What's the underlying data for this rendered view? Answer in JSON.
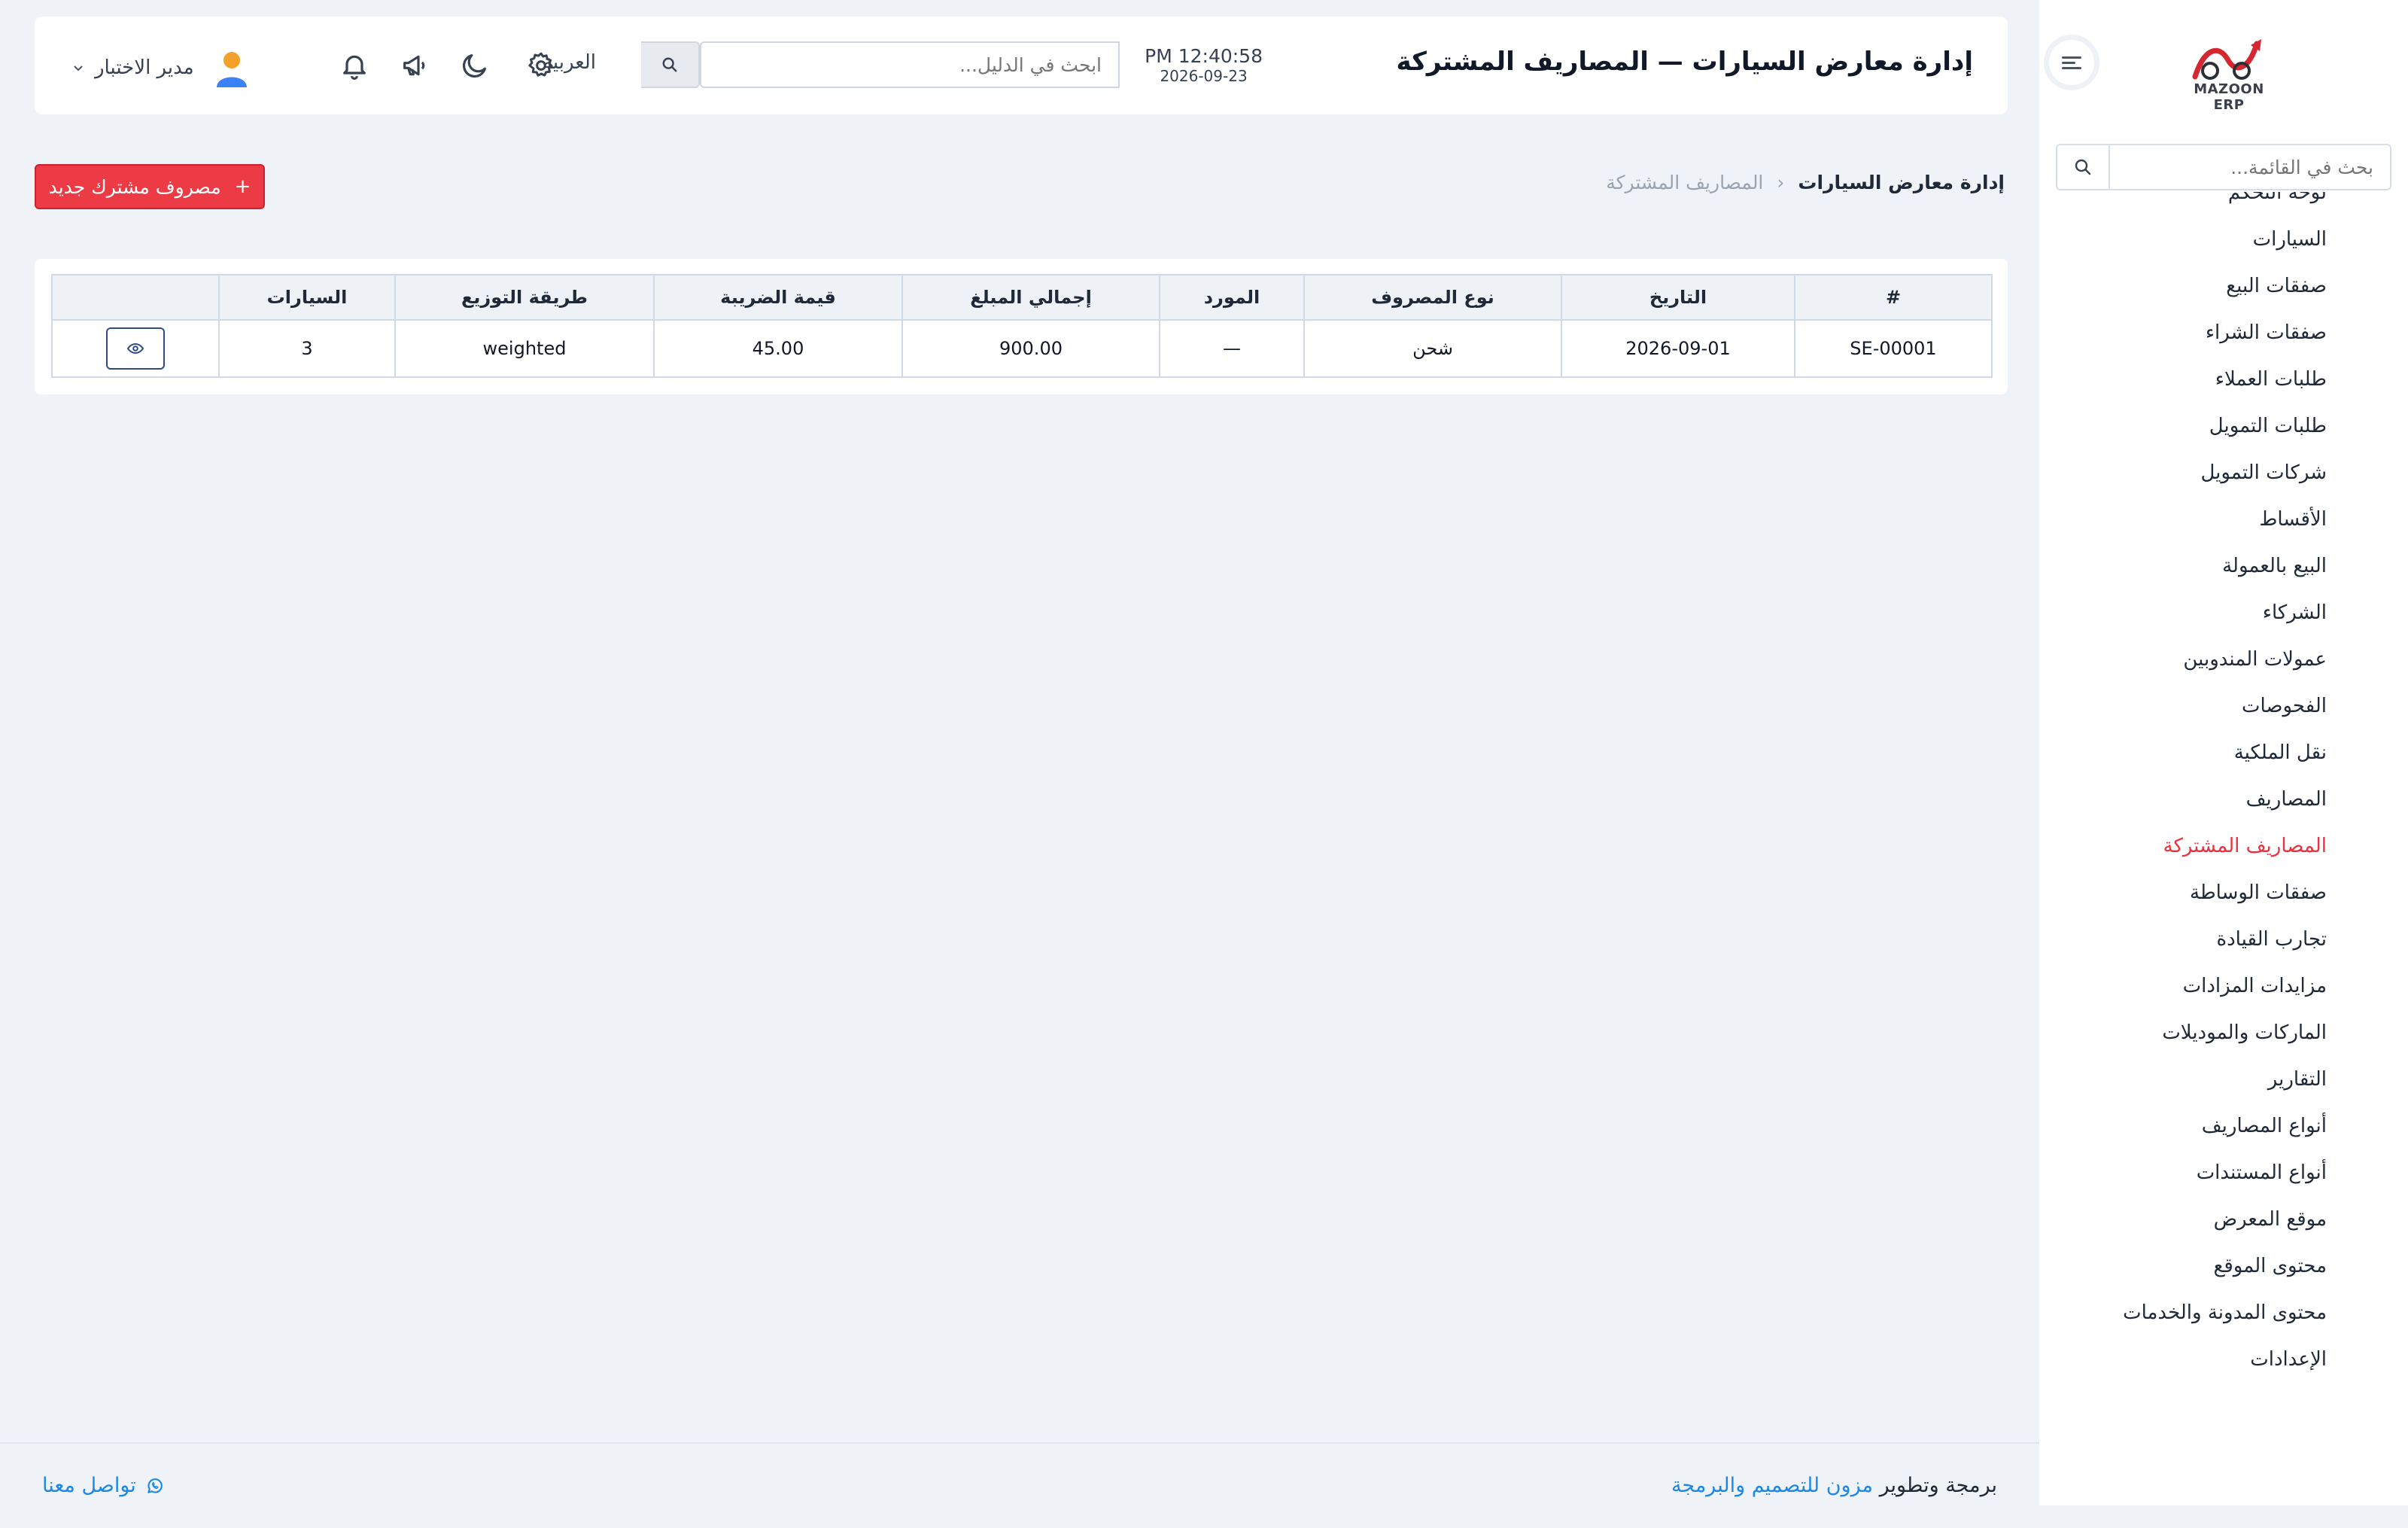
{
  "brand": {
    "logo_text": "MAZOON ERP"
  },
  "sidebar": {
    "search_placeholder": "بحث في القائمة...",
    "items": [
      {
        "label": "لوحة التحكم"
      },
      {
        "label": "السيارات"
      },
      {
        "label": "صفقات البيع"
      },
      {
        "label": "صفقات الشراء"
      },
      {
        "label": "طلبات العملاء"
      },
      {
        "label": "طلبات التمويل"
      },
      {
        "label": "شركات التمويل"
      },
      {
        "label": "الأقساط"
      },
      {
        "label": "البيع بالعمولة"
      },
      {
        "label": "الشركاء"
      },
      {
        "label": "عمولات المندوبين"
      },
      {
        "label": "الفحوصات"
      },
      {
        "label": "نقل الملكية"
      },
      {
        "label": "المصاريف"
      },
      {
        "label": "المصاريف المشتركة",
        "active": true
      },
      {
        "label": "صفقات الوساطة"
      },
      {
        "label": "تجارب القيادة"
      },
      {
        "label": "مزايدات المزادات"
      },
      {
        "label": "الماركات والموديلات"
      },
      {
        "label": "التقارير"
      },
      {
        "label": "أنواع المصاريف"
      },
      {
        "label": "أنواع المستندات"
      },
      {
        "label": "موقع المعرض"
      },
      {
        "label": "محتوى الموقع"
      },
      {
        "label": "محتوى المدونة والخدمات"
      },
      {
        "label": "الإعدادات"
      }
    ]
  },
  "header": {
    "title": "إدارة معارض السيارات — المصاريف المشتركة",
    "time": "PM 12:40:58",
    "date": "2026-09-23",
    "search_placeholder": "ابحث في الدليل...",
    "language": "العربية",
    "user_name": "مدير الاختبار"
  },
  "breadcrumb": {
    "parent": "إدارة معارض السيارات",
    "current": "المصاريف المشتركة"
  },
  "actions": {
    "add_label": "مصروف مشترك جديد"
  },
  "table": {
    "columns": [
      "#",
      "التاريخ",
      "نوع المصروف",
      "المورد",
      "إجمالي المبلغ",
      "قيمة الضريبة",
      "طريقة التوزيع",
      "السيارات",
      ""
    ],
    "rows": [
      [
        "SE-00001",
        "2026-09-01",
        "شحن",
        "—",
        "900.00",
        "45.00",
        "weighted",
        "3"
      ]
    ]
  },
  "footer": {
    "credit_prefix": "برمجة وتطوير",
    "credit_link": "مزون للتصميم والبرمجة",
    "contact": "تواصل معنا"
  },
  "colors": {
    "accent": "#ed3b46",
    "active_menu": "#e8323f",
    "link": "#1e88e5",
    "background": "#eff3f7"
  },
  "icons": [
    "search-icon",
    "menu-toggle-icon",
    "gear-icon",
    "moon-icon",
    "megaphone-icon",
    "bell-icon",
    "user-avatar-icon",
    "chevron-down-icon",
    "eye-icon",
    "plus-icon",
    "whatsapp-icon"
  ]
}
